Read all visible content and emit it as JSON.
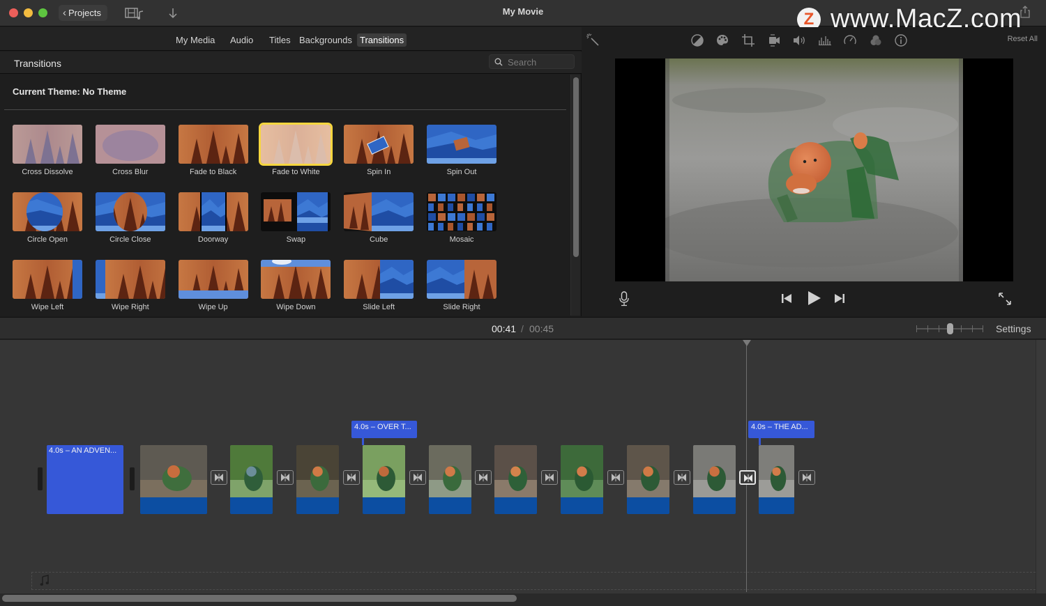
{
  "window": {
    "title": "My Movie",
    "projects_label": "Projects",
    "watermark_logo": "Z",
    "watermark_text": "www.MacZ.com"
  },
  "browser": {
    "tabs": [
      {
        "label": "My Media",
        "active": false
      },
      {
        "label": "Audio",
        "active": false
      },
      {
        "label": "Titles",
        "active": false
      },
      {
        "label": "Backgrounds",
        "active": false
      },
      {
        "label": "Transitions",
        "active": true
      }
    ],
    "section_title": "Transitions",
    "search": {
      "placeholder": "Search",
      "value": ""
    },
    "theme_label": "Current Theme: No Theme",
    "transitions": [
      {
        "label": "Cross Dissolve",
        "style": "dissolve"
      },
      {
        "label": "Cross Blur",
        "style": "blur"
      },
      {
        "label": "Fade to Black",
        "style": "forest"
      },
      {
        "label": "Fade to White",
        "style": "white",
        "selected": true
      },
      {
        "label": "Spin In",
        "style": "spinin"
      },
      {
        "label": "Spin Out",
        "style": "spinout"
      },
      {
        "label": "Circle Open",
        "style": "circleopen"
      },
      {
        "label": "Circle Close",
        "style": "circleclose"
      },
      {
        "label": "Doorway",
        "style": "doorway"
      },
      {
        "label": "Swap",
        "style": "swap"
      },
      {
        "label": "Cube",
        "style": "cube"
      },
      {
        "label": "Mosaic",
        "style": "mosaic"
      },
      {
        "label": "Wipe Left",
        "style": "wipeleft"
      },
      {
        "label": "Wipe Right",
        "style": "wiperight"
      },
      {
        "label": "Wipe Up",
        "style": "wipeup"
      },
      {
        "label": "Wipe Down",
        "style": "wipedown"
      },
      {
        "label": "Slide Left",
        "style": "slideleft"
      },
      {
        "label": "Slide Right",
        "style": "slideright"
      }
    ]
  },
  "viewer": {
    "toolbar_icons": [
      "magic-wand",
      "color-balance",
      "color-correction",
      "crop",
      "stabilization",
      "volume",
      "noise-reduction",
      "speed",
      "clip-filter",
      "info"
    ],
    "reset_all_label": "Reset All"
  },
  "timeline": {
    "current_time": "00:41",
    "separator": "/",
    "total_time": "00:45",
    "settings_label": "Settings",
    "zoom_level_fraction": 0.5,
    "title_clips": [
      {
        "label": "4.0s – AN ADVEN..."
      }
    ],
    "title_flags": [
      {
        "label": "4.0s – OVER T..."
      },
      {
        "label": "4.0s – THE AD..."
      }
    ],
    "video_clip_count": 10,
    "transition_count": 10,
    "selected_transition_index": 8
  },
  "colors": {
    "selection": "#f6d63f",
    "title_clip": "#3658d8",
    "audio_bar": "#0c4ea2"
  }
}
